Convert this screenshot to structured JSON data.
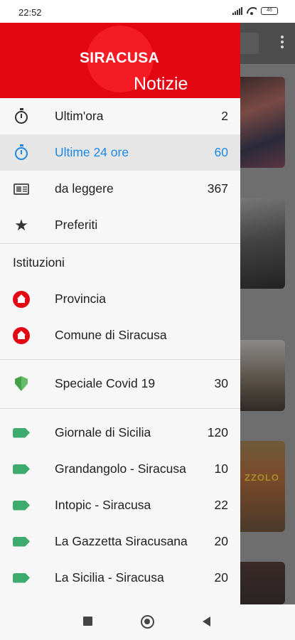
{
  "status_bar": {
    "time": "22:52",
    "battery": "46",
    "icons": [
      "signal-icon",
      "wifi-icon",
      "battery-icon"
    ]
  },
  "drawer": {
    "header": {
      "brand_top": "SIRACUSA",
      "brand_bottom": "Notizie",
      "color": "#e30613"
    },
    "main_items": [
      {
        "label": "Ultim'ora",
        "count": "2",
        "icon": "stopwatch-icon"
      },
      {
        "label": "Ultime 24 ore",
        "count": "60",
        "icon": "stopwatch-icon",
        "active": true
      },
      {
        "label": "da leggere",
        "count": "367",
        "icon": "reader-icon"
      },
      {
        "label": "Preferiti",
        "count": "",
        "icon": "star-icon"
      }
    ],
    "institutions_title": "Istituzioni",
    "institutions": [
      {
        "label": "Provincia",
        "icon": "home-badge-icon"
      },
      {
        "label": "Comune di Siracusa",
        "icon": "home-badge-icon"
      }
    ],
    "special": {
      "label": "Speciale Covid 19",
      "count": "30",
      "icon": "shield-icon"
    },
    "sources": [
      {
        "label": "Giornale di Sicilia",
        "count": "120",
        "icon": "tag-icon"
      },
      {
        "label": "Grandangolo - Siracusa",
        "count": "10",
        "icon": "tag-icon"
      },
      {
        "label": "Intopic - Siracusa",
        "count": "22",
        "icon": "tag-icon"
      },
      {
        "label": "La Gazzetta Siracusana",
        "count": "20",
        "icon": "tag-icon"
      },
      {
        "label": "La Sicilia - Siracusa",
        "count": "20",
        "icon": "tag-icon"
      }
    ],
    "accent_color": "#1e88e5",
    "tag_color": "#3daa6e"
  },
  "background_app": {
    "thumb_text": "ZZOLO"
  },
  "nav_bar": {
    "buttons": [
      "recents-button",
      "home-button",
      "back-button"
    ]
  }
}
